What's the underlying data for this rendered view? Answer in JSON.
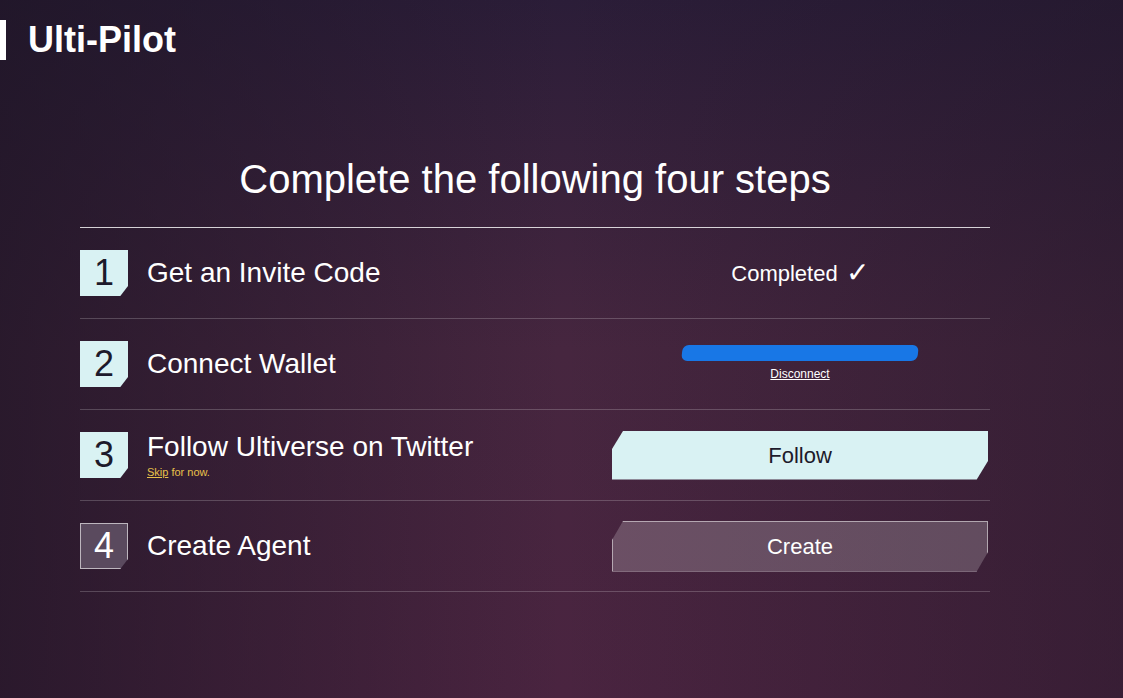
{
  "app": {
    "title": "Ulti-Pilot"
  },
  "heading": "Complete the following four steps",
  "steps": [
    {
      "number": "1",
      "label": "Get an Invite Code",
      "kind": "status",
      "highlighted": true,
      "status": "Completed",
      "status_icon": "✓"
    },
    {
      "number": "2",
      "label": "Connect Wallet",
      "kind": "wallet",
      "highlighted": true,
      "address_redacted": true,
      "action": "Disconnect"
    },
    {
      "number": "3",
      "label": "Follow Ultiverse on Twitter",
      "kind": "button",
      "highlighted": true,
      "button": "Follow",
      "skip": {
        "link": "Skip",
        "text": "for now."
      }
    },
    {
      "number": "4",
      "label": "Create Agent",
      "kind": "button",
      "highlighted": false,
      "button": "Create"
    }
  ]
}
